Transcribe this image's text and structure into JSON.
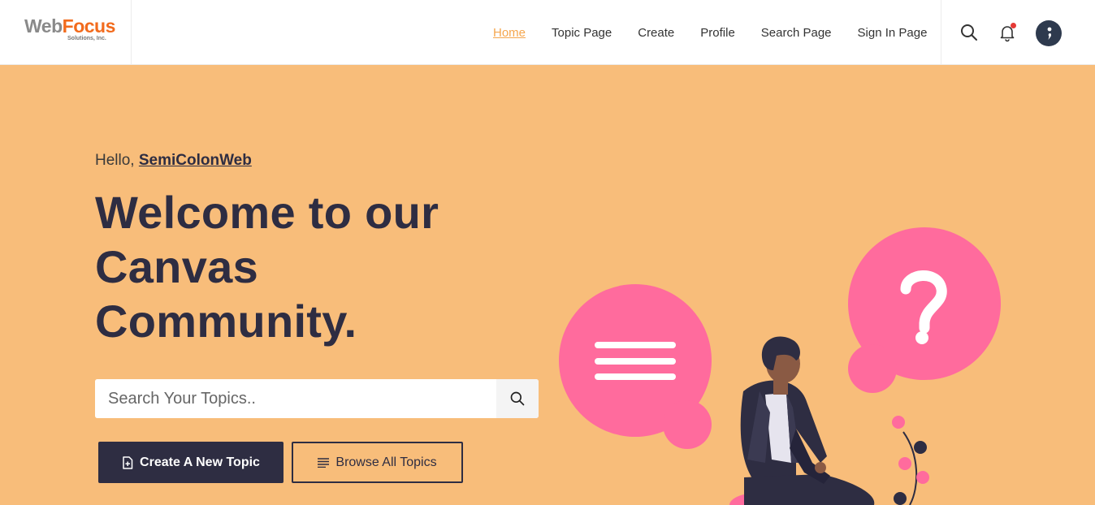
{
  "header": {
    "logo": {
      "main_a": "Web",
      "main_b": "Focus",
      "sub": "Solutions, Inc."
    },
    "nav": [
      {
        "label": "Home",
        "active": true
      },
      {
        "label": "Topic Page",
        "active": false
      },
      {
        "label": "Create",
        "active": false
      },
      {
        "label": "Profile",
        "active": false
      },
      {
        "label": "Search Page",
        "active": false
      },
      {
        "label": "Sign In Page",
        "active": false
      }
    ],
    "icons": [
      "search-icon",
      "bell-icon",
      "avatar"
    ]
  },
  "hero": {
    "greeting": "Hello,",
    "username": "SemiColonWeb",
    "headline_line1": "Welcome to our",
    "headline_line2": "Canvas",
    "headline_line3": "Community.",
    "search": {
      "placeholder": "Search Your Topics..",
      "value": ""
    },
    "create_label": "Create A New Topic",
    "browse_label": "Browse All Topics"
  },
  "colors": {
    "background": "#f8bd7a",
    "accent": "#f5a64d",
    "dark": "#2e2d42",
    "pink": "#ff6b9d"
  }
}
